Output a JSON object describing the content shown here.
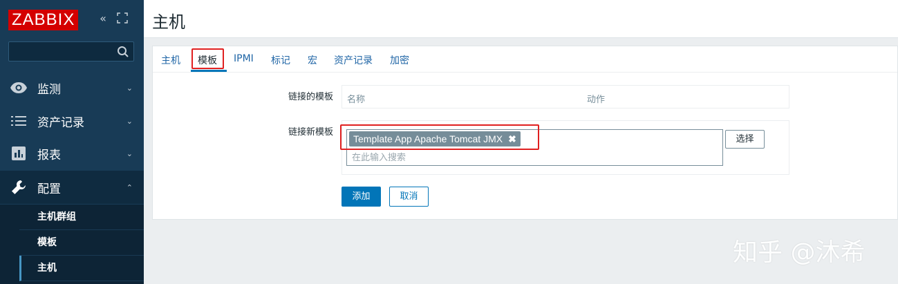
{
  "brand": {
    "logo_text": "ZABBIX",
    "logo_color": "#d40000"
  },
  "sidebar": {
    "nav": [
      {
        "label": "监测",
        "icon": "eye-icon"
      },
      {
        "label": "资产记录",
        "icon": "list-icon"
      },
      {
        "label": "报表",
        "icon": "bar-chart-icon"
      },
      {
        "label": "配置",
        "icon": "wrench-icon"
      }
    ],
    "sub_items": [
      {
        "label": "主机群组"
      },
      {
        "label": "模板"
      },
      {
        "label": "主机"
      }
    ]
  },
  "page": {
    "title": "主机"
  },
  "tabs": [
    {
      "label": "主机"
    },
    {
      "label": "模板"
    },
    {
      "label": "IPMI"
    },
    {
      "label": "标记"
    },
    {
      "label": "宏"
    },
    {
      "label": "资产记录"
    },
    {
      "label": "加密"
    }
  ],
  "form": {
    "linked_label": "链接的模板",
    "linked_columns": {
      "name": "名称",
      "action": "动作"
    },
    "new_label": "链接新模板",
    "selected_tag": "Template App Apache Tomcat JMX",
    "remove_glyph": "✖",
    "search_placeholder": "在此输入搜索",
    "select_button": "选择",
    "add_button": "添加",
    "cancel_button": "取消"
  },
  "watermark": "知乎 @沐希",
  "colors": {
    "sidebar": "#183b56",
    "accent": "#0275b8",
    "highlight": "#e02020"
  }
}
